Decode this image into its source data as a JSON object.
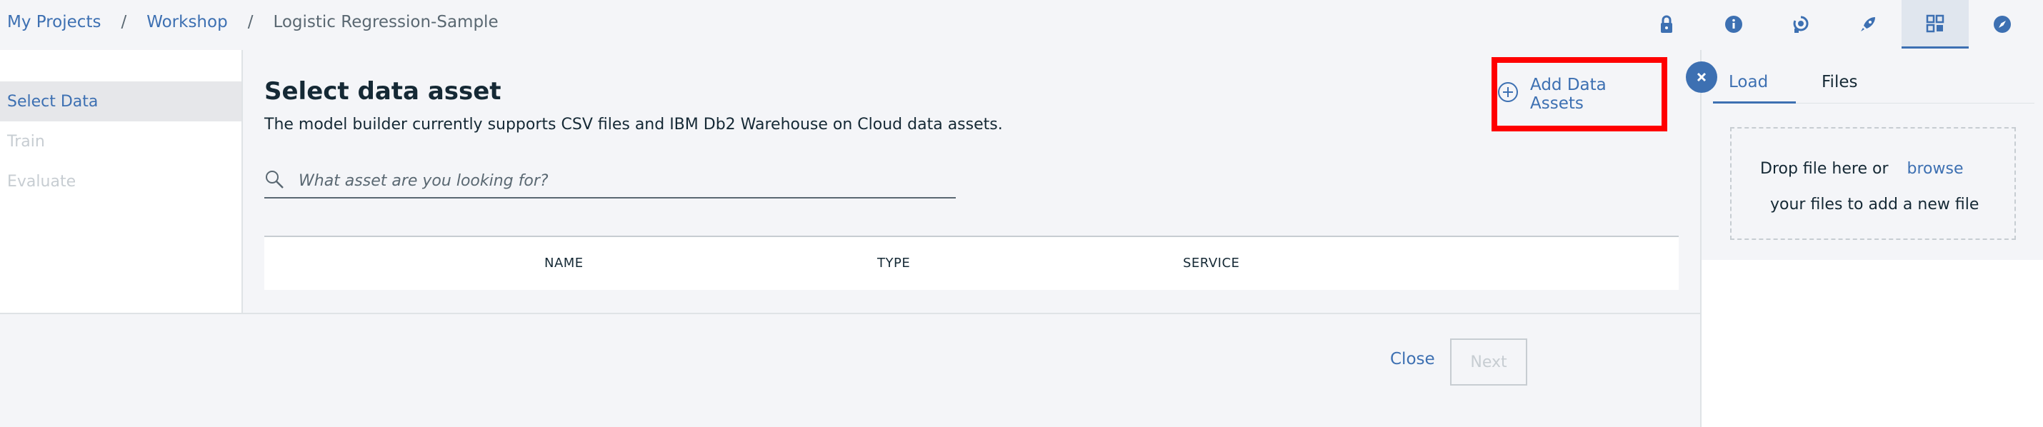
{
  "breadcrumb": {
    "items": [
      "My Projects",
      "Workshop"
    ],
    "separator": "/",
    "current": "Logistic Regression-Sample"
  },
  "top_icons": [
    "lock-icon",
    "info-icon",
    "flow-icon",
    "rocket-icon",
    "data-icon",
    "compass-icon"
  ],
  "sidebar": {
    "items": [
      {
        "label": "Select Data",
        "active": true
      },
      {
        "label": "Train",
        "active": false
      },
      {
        "label": "Evaluate",
        "active": false
      }
    ]
  },
  "main": {
    "title": "Select data asset",
    "subtitle": "The model builder currently supports CSV files and IBM Db2 Warehouse on Cloud data assets.",
    "add_assets_label": "Add Data Assets",
    "search_placeholder": "What asset are you looking for?",
    "columns": [
      "NAME",
      "TYPE",
      "SERVICE"
    ]
  },
  "footer": {
    "close_label": "Close",
    "next_label": "Next"
  },
  "panel": {
    "tabs": [
      "Load",
      "Files"
    ],
    "active_tab": "Load",
    "drop_text": "Drop file here or",
    "browse_label": "browse",
    "drop_text2": "your files to add a new file"
  },
  "colors": {
    "accent": "#3d70b2",
    "highlight_box": "#ff0000",
    "text": "#152935",
    "muted": "#c7cdd2"
  }
}
